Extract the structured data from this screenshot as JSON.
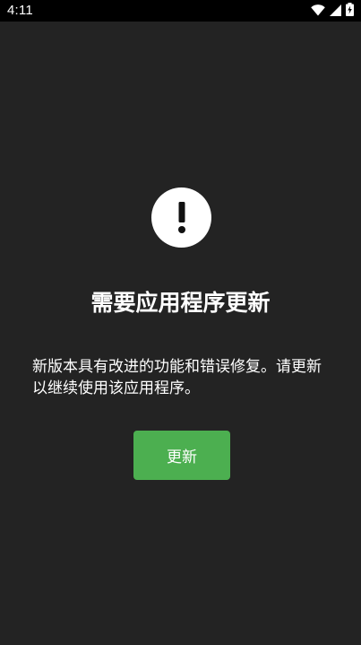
{
  "status_bar": {
    "time": "4:11",
    "icons": [
      "wifi-icon",
      "cellular-signal-icon",
      "battery-charging-icon"
    ]
  },
  "dialog": {
    "icon": "exclamation-icon",
    "title": "需要应用程序更新",
    "description": "新版本具有改进的功能和错误修复。请更新以继续使用该应用程序。",
    "update_button_label": "更新"
  },
  "colors": {
    "background": "#232323",
    "status_bar": "#000000",
    "button": "#4caf50",
    "text": "#ffffff"
  }
}
